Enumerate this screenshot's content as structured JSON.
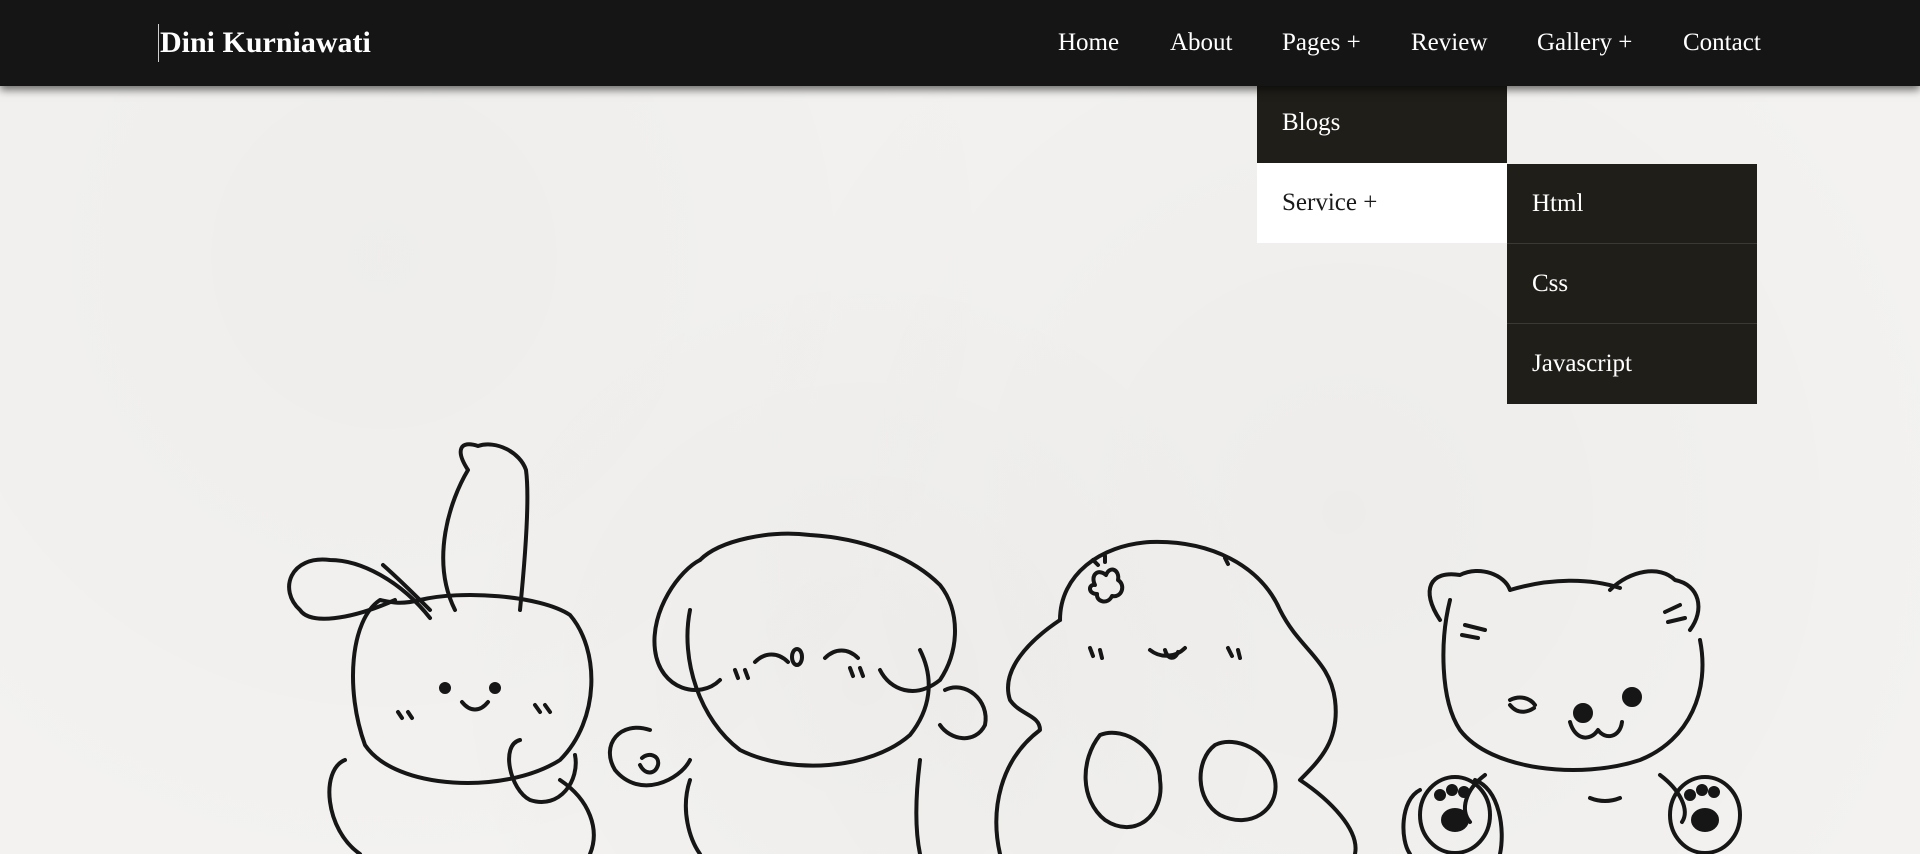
{
  "brand": {
    "name": "Dini Kurniawati"
  },
  "nav": {
    "items": [
      {
        "label": "Home"
      },
      {
        "label": "About"
      },
      {
        "label": "Pages +"
      },
      {
        "label": "Review"
      },
      {
        "label": "Gallery +"
      },
      {
        "label": "Contact"
      }
    ]
  },
  "pages_dropdown": {
    "items": [
      {
        "label": "Blogs"
      },
      {
        "label": "Service +"
      }
    ]
  },
  "service_submenu": {
    "items": [
      {
        "label": "Html"
      },
      {
        "label": "Css"
      },
      {
        "label": "Javascript"
      }
    ]
  },
  "colors": {
    "navbar_bg": "#151515",
    "dropdown_bg": "#1f1e19",
    "hover_bg": "#ffffff",
    "page_bg": "#f3f2f0"
  }
}
